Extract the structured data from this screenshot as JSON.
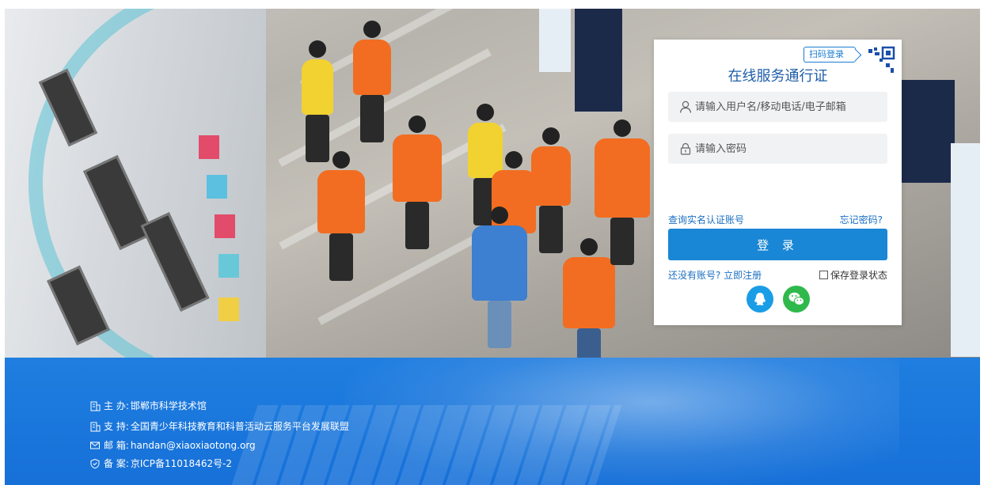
{
  "login": {
    "scan_label": "扫码登录",
    "title": "在线服务通行证",
    "username_placeholder": "请输入用户名/移动电话/电子邮箱",
    "password_placeholder": "请输入密码",
    "verify_link": "查询实名认证账号",
    "forgot_link": "忘记密码?",
    "login_button": "登 录",
    "register_link": "还没有账号? 立即注册",
    "remember_label": "保存登录状态"
  },
  "footer": {
    "host_label": "主 办:",
    "host_value": "邯郸市科学技术馆",
    "support_label": "支 持:",
    "support_value": "全国青少年科技教育和科普活动云服务平台发展联盟",
    "email_label": "邮 箱:",
    "email_value": "handan@xiaoxiaotong.org",
    "icp_label": "备 案:",
    "icp_value": "京ICP备11018462号-2"
  },
  "colors": {
    "accent": "#1a87d6",
    "title": "#1f5ea8",
    "footer_bg": "#1670d8",
    "qq": "#1a9de6",
    "wechat": "#2fb94c"
  },
  "icons": [
    "qr-code-icon",
    "user-icon",
    "lock-icon",
    "qq-icon",
    "wechat-icon",
    "building-icon",
    "mail-icon",
    "shield-icon"
  ]
}
